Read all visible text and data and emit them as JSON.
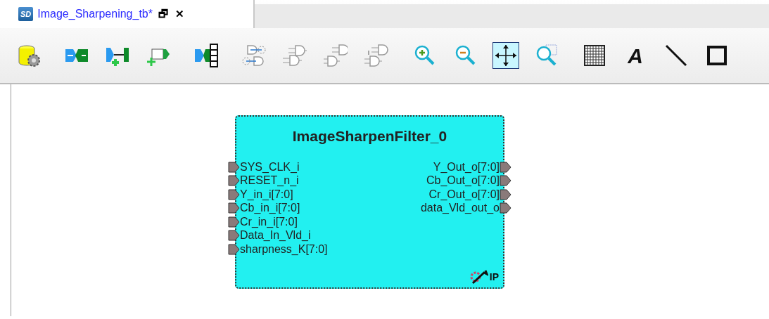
{
  "tab": {
    "badge": "SD",
    "title": "Image_Sharpening_tb*",
    "restore": "🗗",
    "close": "✕"
  },
  "toolbar": [
    {
      "kind": "config",
      "selected": false
    },
    {
      "kind": "connect",
      "selected": false
    },
    {
      "kind": "addport",
      "selected": false
    },
    {
      "kind": "port",
      "selected": false
    },
    {
      "kind": "bus",
      "selected": false
    },
    {
      "kind": "swap",
      "selected": false
    },
    {
      "kind": "gate1",
      "selected": false
    },
    {
      "kind": "gate2",
      "selected": false
    },
    {
      "kind": "gate3",
      "selected": false
    },
    {
      "kind": "zoomin",
      "selected": false
    },
    {
      "kind": "zoomout",
      "selected": false
    },
    {
      "kind": "fit",
      "selected": true
    },
    {
      "kind": "zoomarea",
      "selected": false
    },
    {
      "kind": "grid",
      "selected": false
    },
    {
      "kind": "text",
      "selected": false,
      "label": "A"
    },
    {
      "kind": "line",
      "selected": false
    },
    {
      "kind": "rect",
      "selected": false
    }
  ],
  "block": {
    "title": "ImageSharpenFilter_0",
    "inputs": [
      "SYS_CLK_i",
      "RESET_n_i",
      "Y_in_i[7:0]",
      "Cb_in_i[7:0]",
      "Cr_in_i[7:0]",
      "Data_In_Vld_i",
      "sharpness_K[7:0]"
    ],
    "outputs": [
      "Y_Out_o[7:0]",
      "Cb_Out_o[7:0]",
      "Cr_Out_o[7:0]",
      "data_Vld_out_o"
    ],
    "ip_label": "IP"
  }
}
